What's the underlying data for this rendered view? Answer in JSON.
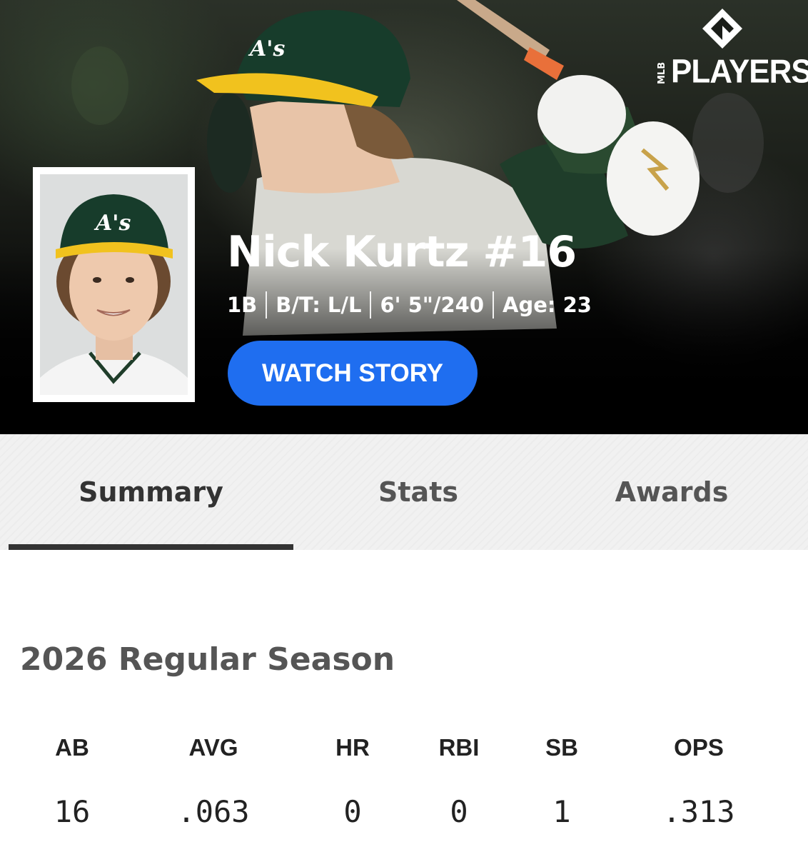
{
  "brand": {
    "mlb_text": "MLB",
    "players_text": "PLAYERS"
  },
  "player": {
    "name": "Nick Kurtz #16",
    "bio": [
      "1B",
      "B/T: L/L",
      "6' 5\"/240",
      "Age: 23"
    ],
    "cap_logo": "A's"
  },
  "watch_button_label": "WATCH STORY",
  "tabs": [
    {
      "label": "Summary",
      "active": true
    },
    {
      "label": "Stats",
      "active": false
    },
    {
      "label": "Awards",
      "active": false
    }
  ],
  "season_title": "2026 Regular Season",
  "stats": {
    "headers": [
      "AB",
      "AVG",
      "HR",
      "RBI",
      "SB",
      "OPS"
    ],
    "values": [
      "16",
      ".063",
      "0",
      "0",
      "1",
      ".313"
    ]
  },
  "colors": {
    "accent_button": "#1f6ef0",
    "team_green": "#0f3d2c",
    "team_gold": "#efb21e"
  }
}
